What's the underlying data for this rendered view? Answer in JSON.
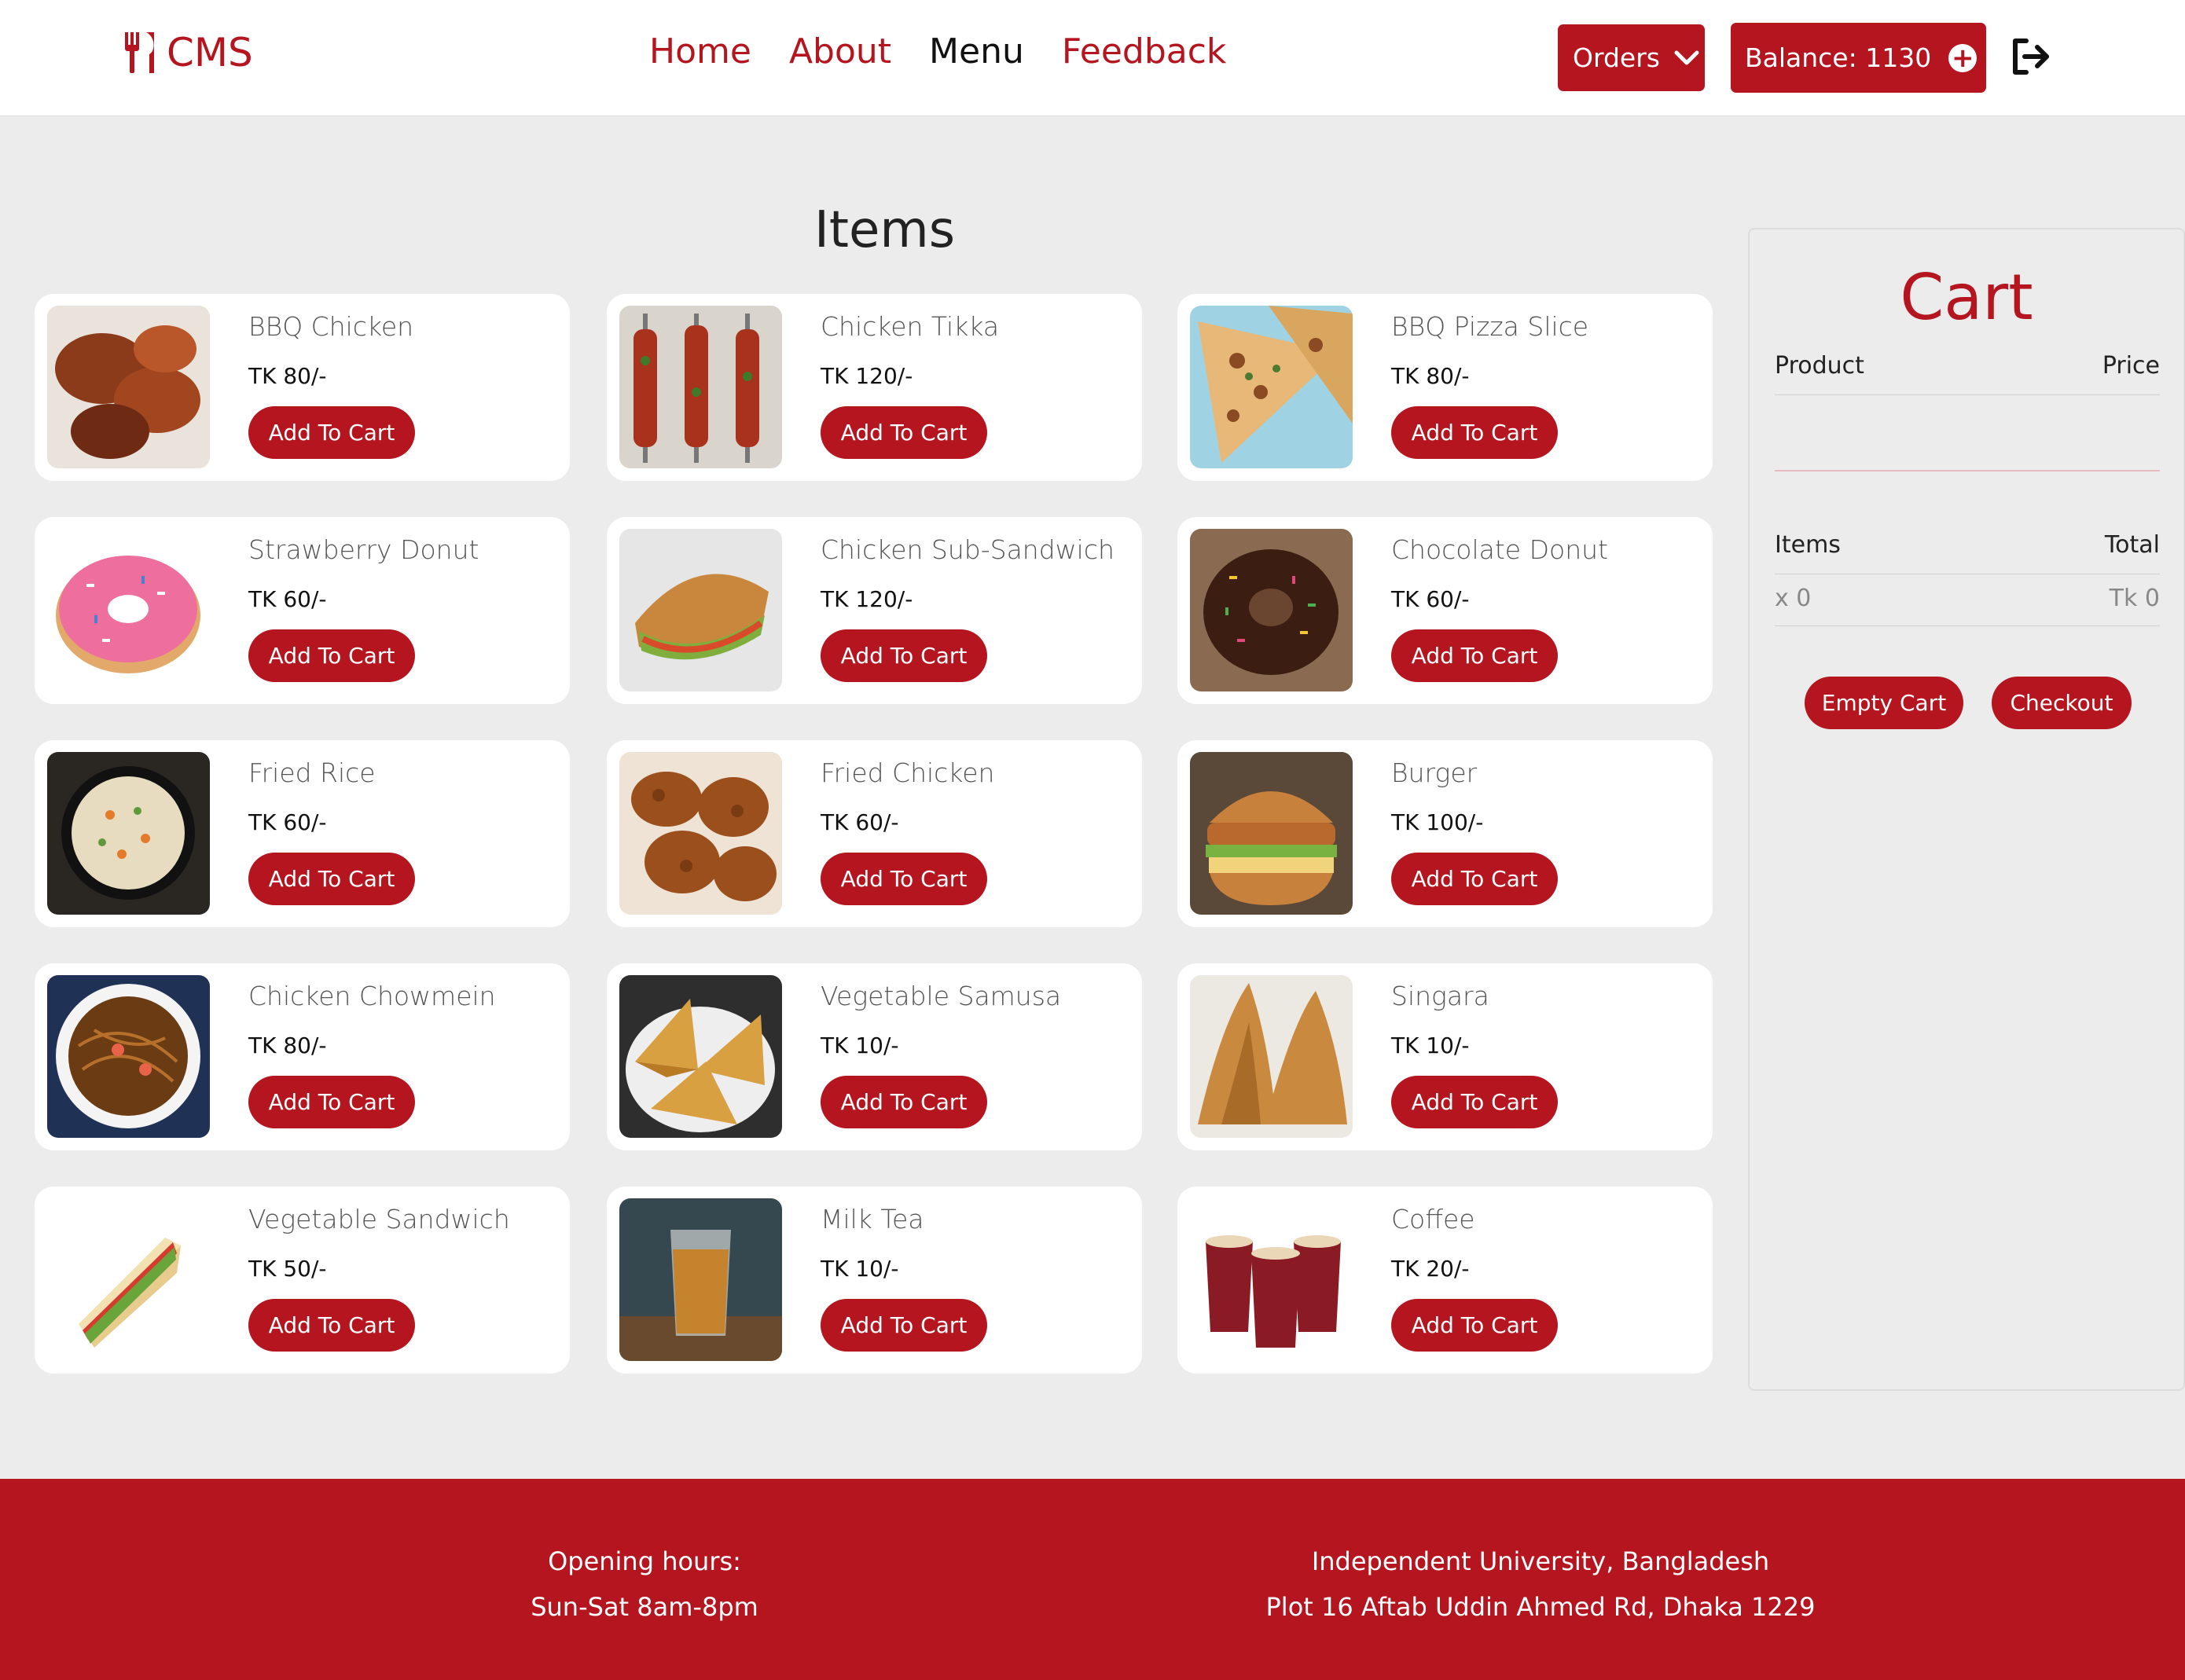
{
  "nav": {
    "brand": "CMS",
    "links": [
      "Home",
      "About",
      "Menu",
      "Feedback"
    ],
    "active": "Menu",
    "orders_label": "Orders",
    "balance_label": "Balance: 1130"
  },
  "items_title": "Items",
  "items": [
    {
      "name": "BBQ Chicken",
      "price": "TK 80/-",
      "button": "Add To Cart"
    },
    {
      "name": "Chicken Tikka",
      "price": "TK 120/-",
      "button": "Add To Cart"
    },
    {
      "name": "BBQ Pizza Slice",
      "price": "TK 80/-",
      "button": "Add To Cart"
    },
    {
      "name": "Strawberry Donut",
      "price": "TK 60/-",
      "button": "Add To Cart"
    },
    {
      "name": "Chicken Sub-Sandwich",
      "price": "TK 120/-",
      "button": "Add To Cart"
    },
    {
      "name": "Chocolate Donut",
      "price": "TK 60/-",
      "button": "Add To Cart"
    },
    {
      "name": "Fried Rice",
      "price": "TK 60/-",
      "button": "Add To Cart"
    },
    {
      "name": "Fried Chicken",
      "price": "TK 60/-",
      "button": "Add To Cart"
    },
    {
      "name": "Burger",
      "price": "TK 100/-",
      "button": "Add To Cart"
    },
    {
      "name": "Chicken Chowmein",
      "price": "TK 80/-",
      "button": "Add To Cart"
    },
    {
      "name": "Vegetable Samusa",
      "price": "TK 10/-",
      "button": "Add To Cart"
    },
    {
      "name": "Singara",
      "price": "TK 10/-",
      "button": "Add To Cart"
    },
    {
      "name": "Vegetable Sandwich",
      "price": "TK 50/-",
      "button": "Add To Cart"
    },
    {
      "name": "Milk Tea",
      "price": "TK 10/-",
      "button": "Add To Cart"
    },
    {
      "name": "Coffee",
      "price": "TK 20/-",
      "button": "Add To Cart"
    }
  ],
  "cart": {
    "title": "Cart",
    "product_header": "Product",
    "price_header": "Price",
    "items_header": "Items",
    "total_header": "Total",
    "items_value": "x 0",
    "total_value": "Tk 0",
    "empty_button": "Empty Cart",
    "checkout_button": "Checkout"
  },
  "footer": {
    "hours_title": "Opening hours:",
    "hours_value": "Sun-Sat 8am-8pm",
    "address_line1": "Independent University, Bangladesh",
    "address_line2": "Plot 16 Aftab Uddin Ahmed Rd, Dhaka 1229"
  },
  "colors": {
    "accent": "#b5151f",
    "background": "#ececec"
  },
  "icons": {
    "brand": "utensils-icon",
    "orders": "chevron-down-icon",
    "balance": "plus-circle-icon",
    "logout": "logout-icon"
  }
}
